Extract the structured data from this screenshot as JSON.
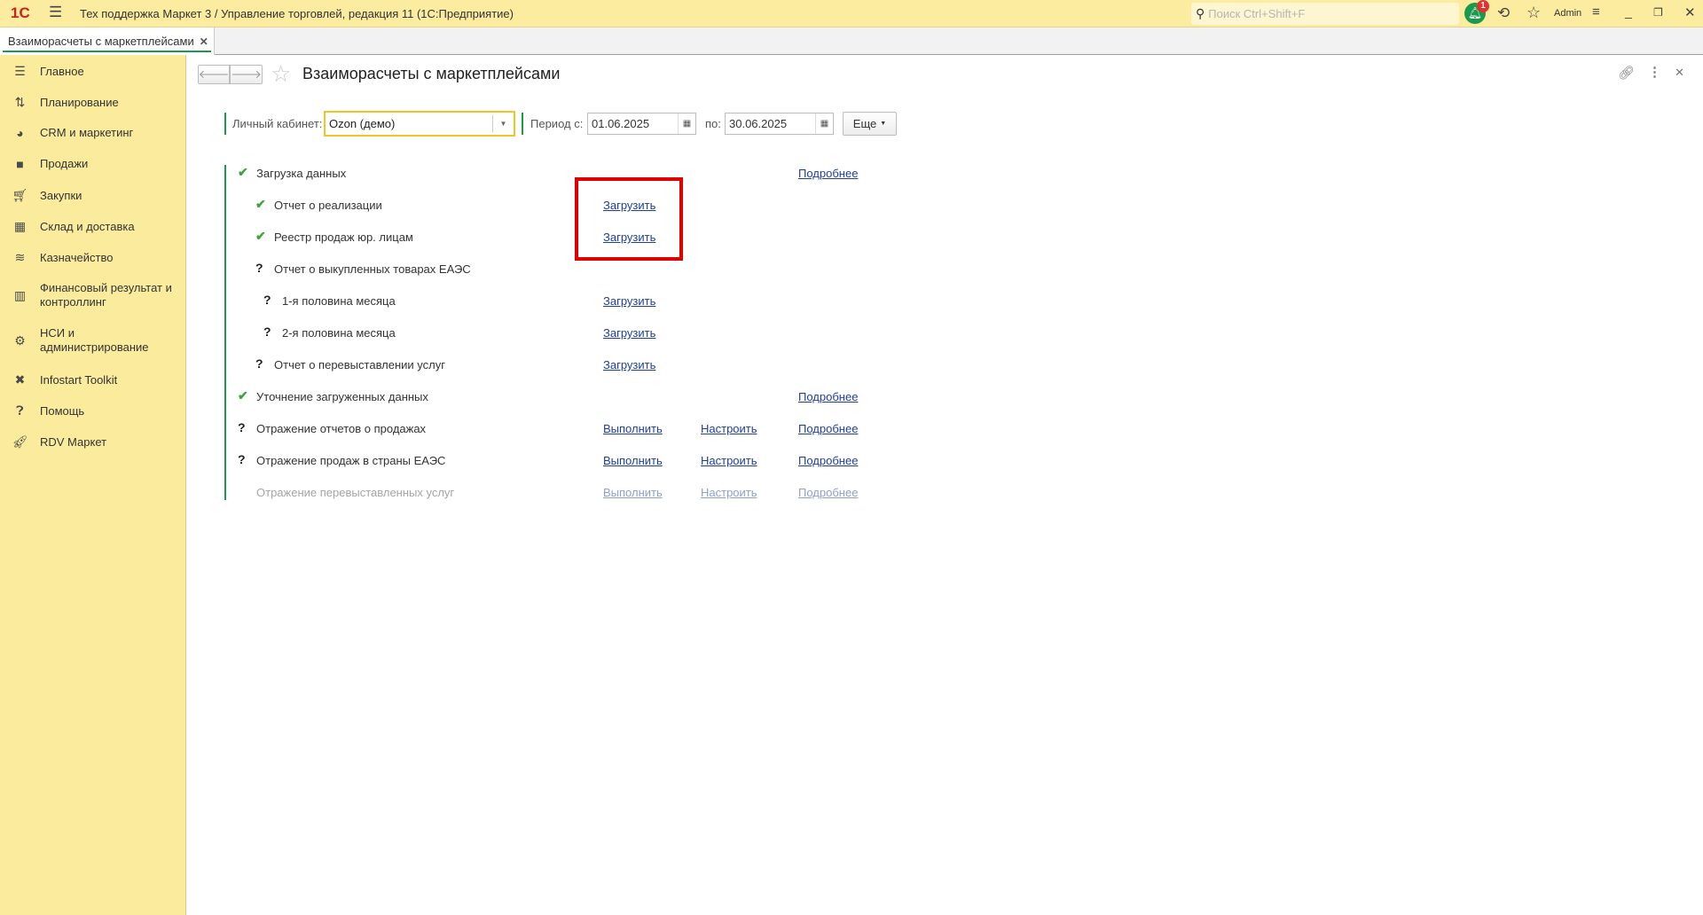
{
  "app": {
    "logo": "1С",
    "title": "Тех поддержка Маркет 3 / Управление торговлей, редакция 11  (1С:Предприятие)",
    "search_placeholder": "Поиск Ctrl+Shift+F",
    "notification_count": "1",
    "user": "Admin"
  },
  "tabs": [
    {
      "label": "Взаиморасчеты с маркетплейсами",
      "active": true
    }
  ],
  "sidebar": {
    "items": [
      {
        "label": "Главное",
        "icon": "menu-icon"
      },
      {
        "label": "Планирование",
        "icon": "planning-icon"
      },
      {
        "label": "CRM и маркетинг",
        "icon": "pie-chart-icon"
      },
      {
        "label": "Продажи",
        "icon": "bag-icon"
      },
      {
        "label": "Закупки",
        "icon": "cart-icon"
      },
      {
        "label": "Склад и доставка",
        "icon": "warehouse-icon"
      },
      {
        "label": "Казначейство",
        "icon": "coins-icon"
      },
      {
        "label": "Финансовый результат и контроллинг",
        "icon": "bar-chart-icon"
      },
      {
        "label": "НСИ и администрирование",
        "icon": "gear-icon"
      },
      {
        "label": "Infostart Toolkit",
        "icon": "tools-icon"
      },
      {
        "label": "Помощь",
        "icon": "help-icon"
      },
      {
        "label": "RDV Маркет",
        "icon": "rocket-icon"
      }
    ]
  },
  "form": {
    "title": "Взаиморасчеты с маркетплейсами",
    "account_label": "Личный кабинет:",
    "account_value": "Ozon (демо)",
    "period_from_label": "Период с:",
    "period_from": "01.06.2025",
    "period_to_label": "по:",
    "period_to": "30.06.2025",
    "more_label": "Еще"
  },
  "steps": [
    {
      "label": "Загрузка данных",
      "status": "done",
      "level": 0,
      "links": {
        "details": "Подробнее"
      }
    },
    {
      "label": "Отчет о реализации",
      "status": "done",
      "level": 1,
      "links": {
        "load": "Загрузить"
      }
    },
    {
      "label": "Реестр продаж юр. лицам",
      "status": "done",
      "level": 1,
      "links": {
        "load": "Загрузить"
      }
    },
    {
      "label": "Отчет о выкупленных товарах ЕАЭС",
      "status": "unknown",
      "level": 1,
      "links": {}
    },
    {
      "label": "1-я половина месяца",
      "status": "unknown",
      "level": 2,
      "links": {
        "load": "Загрузить"
      }
    },
    {
      "label": "2-я половина месяца",
      "status": "unknown",
      "level": 2,
      "links": {
        "load": "Загрузить"
      }
    },
    {
      "label": "Отчет о перевыставлении услуг",
      "status": "unknown",
      "level": 1,
      "links": {
        "load": "Загрузить"
      }
    },
    {
      "label": "Уточнение загруженных данных",
      "status": "done",
      "level": 0,
      "links": {
        "details": "Подробнее"
      }
    },
    {
      "label": "Отражение отчетов о продажах",
      "status": "unknown",
      "level": 0,
      "links": {
        "run": "Выполнить",
        "setup": "Настроить",
        "details": "Подробнее"
      }
    },
    {
      "label": "Отражение продаж в страны ЕАЭС",
      "status": "unknown",
      "level": 0,
      "links": {
        "run": "Выполнить",
        "setup": "Настроить",
        "details": "Подробнее"
      }
    },
    {
      "label": "Отражение перевыставленных услуг",
      "status": "disabled",
      "level": 0,
      "links": {
        "run": "Выполнить",
        "setup": "Настроить",
        "details": "Подробнее"
      }
    }
  ],
  "colors": {
    "topbar": "#fbeca0",
    "sidebar": "#fbec9d",
    "accent_green": "#1a9a4a",
    "highlight": "#e00000",
    "link": "#1f3f9e"
  }
}
